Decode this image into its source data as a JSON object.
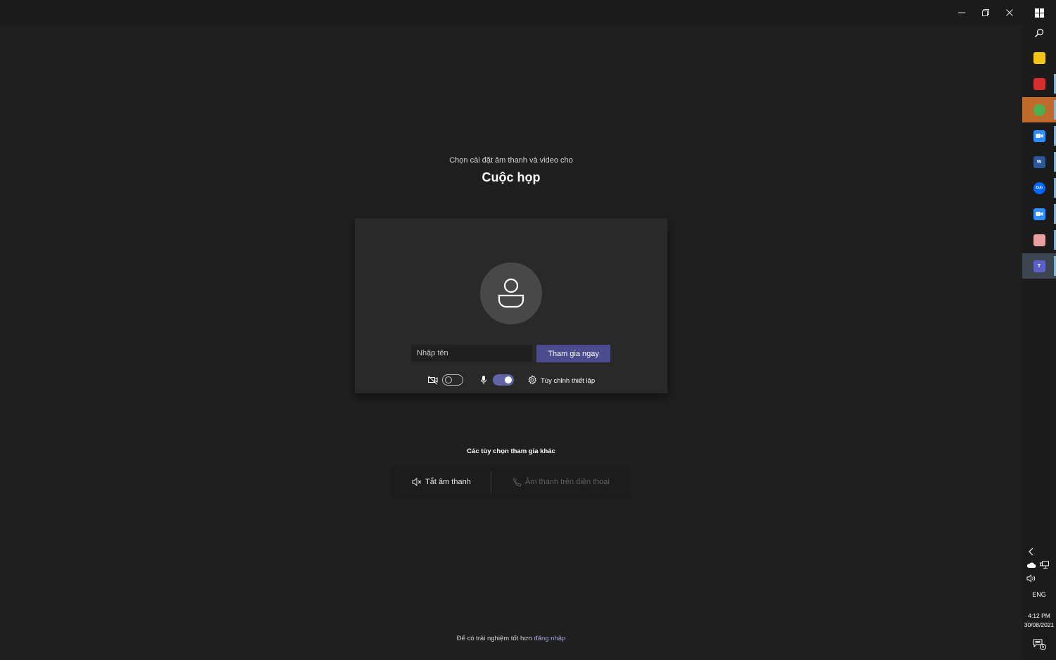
{
  "window": {
    "minimize": "minimize",
    "maximize": "restore",
    "close": "close"
  },
  "prejoin": {
    "subtitle": "Chọn cài đặt âm thanh và video cho",
    "title": "Cuộc họp",
    "name_placeholder": "Nhập tên",
    "join_label": "Tham gia ngay",
    "camera_on": false,
    "mic_on": true,
    "settings_label": "Tùy chỉnh thiết lập"
  },
  "other_options": {
    "title": "Các tùy chọn tham gia khác",
    "mute_label": "Tắt âm thanh",
    "phone_label": "Âm thanh trên điện thoại"
  },
  "footer": {
    "text": "Để có trải nghiệm tốt hơn",
    "link": "đăng nhập"
  },
  "taskbar": {
    "apps": [
      {
        "name": "file-explorer",
        "color": "#f0c419",
        "active": false,
        "selected": false
      },
      {
        "name": "foxit-pdf",
        "color": "#d32f2f",
        "active": false,
        "selected": false
      },
      {
        "name": "chrome",
        "color": "#4caf50",
        "active": true,
        "selected": false
      },
      {
        "name": "zoom",
        "color": "#2d8cff",
        "active": false,
        "selected": false
      },
      {
        "name": "word",
        "color": "#2b579a",
        "active": false,
        "selected": false
      },
      {
        "name": "zalo",
        "color": "#0068ff",
        "active": false,
        "selected": false
      },
      {
        "name": "zoom",
        "color": "#2d8cff",
        "active": false,
        "selected": false
      },
      {
        "name": "paint",
        "color": "#e9a0a0",
        "active": false,
        "selected": false
      },
      {
        "name": "teams",
        "color": "#5b5fc7",
        "active": false,
        "selected": true
      }
    ],
    "language": "ENG",
    "time": "4:12 PM",
    "date": "30/08/2021",
    "notification_count": "5"
  },
  "colors": {
    "accent": "#6264a7",
    "join_button": "#4b4c8f",
    "background": "#1f1f1f",
    "panel": "#292929"
  }
}
